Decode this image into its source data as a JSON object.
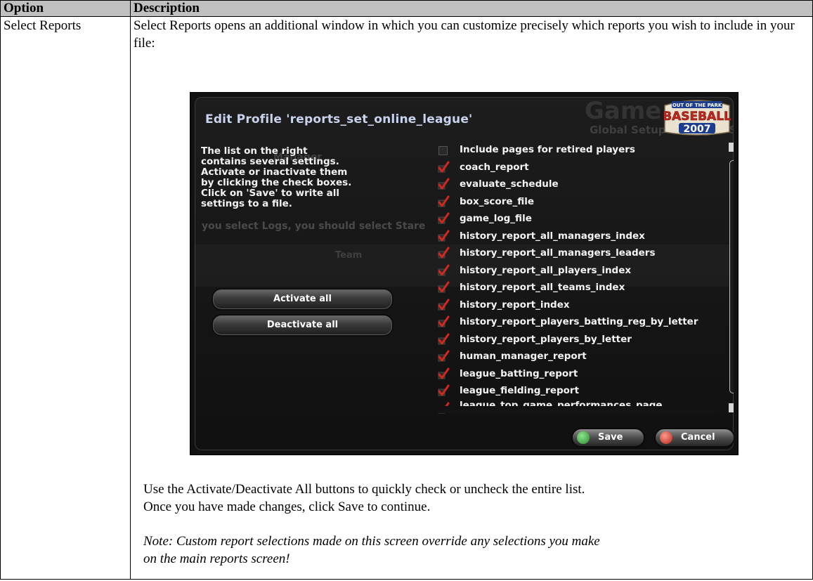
{
  "table": {
    "header_option": "Option",
    "header_description": "Description",
    "option_name": "Select Reports",
    "intro": "Select Reports opens an additional window in which you can customize precisely which reports you wish to include in your file:",
    "body_line1": "Use the Activate/Deactivate All buttons to quickly check or uncheck the entire list.",
    "body_line2": "Once you have made changes, click Save to continue.",
    "note_line1": "Note: Custom report selections made on this screen override any selections you make",
    "note_line2": "on the main reports screen!"
  },
  "dialog": {
    "title": "Edit Profile 'reports_set_online_league'",
    "background_title": "Game Setup",
    "background_subtitle": "Global Setup & League Setup",
    "background_tab": "Manager",
    "background_hint": "you select                          Logs, you should select Stare",
    "background_team": "Team",
    "logo": {
      "line1": "OUT OF THE PARK",
      "line2": "BASEBALL",
      "line3": "2007"
    },
    "help_text": "The list on the right contains several settings. Activate or inactivate them by clicking the check boxes. Click on 'Save' to write all settings to a file.",
    "activate_all": "Activate all",
    "deactivate_all": "Deactivate all",
    "items": [
      {
        "label": "Include pages for retired players",
        "checked": false
      },
      {
        "label": "coach_report",
        "checked": true
      },
      {
        "label": "evaluate_schedule",
        "checked": true
      },
      {
        "label": "box_score_file",
        "checked": true
      },
      {
        "label": "game_log_file",
        "checked": true
      },
      {
        "label": "history_report_all_managers_index",
        "checked": true
      },
      {
        "label": "history_report_all_managers_leaders",
        "checked": true
      },
      {
        "label": "history_report_all_players_index",
        "checked": true
      },
      {
        "label": "history_report_all_teams_index",
        "checked": true
      },
      {
        "label": "history_report_index",
        "checked": true
      },
      {
        "label": "history_report_players_batting_reg_by_letter",
        "checked": true
      },
      {
        "label": "history_report_players_by_letter",
        "checked": true
      },
      {
        "label": "human_manager_report",
        "checked": true
      },
      {
        "label": "league_batting_report",
        "checked": true
      },
      {
        "label": "league_fielding_report",
        "checked": true
      },
      {
        "label": "league_top_game_performances_page",
        "checked": true
      }
    ],
    "save": "Save",
    "cancel": "Cancel",
    "colors": {
      "check": "#d0281e",
      "title": "#c9d3ee",
      "logo_red": "#c8261c",
      "logo_blue": "#1d3d8f"
    }
  }
}
